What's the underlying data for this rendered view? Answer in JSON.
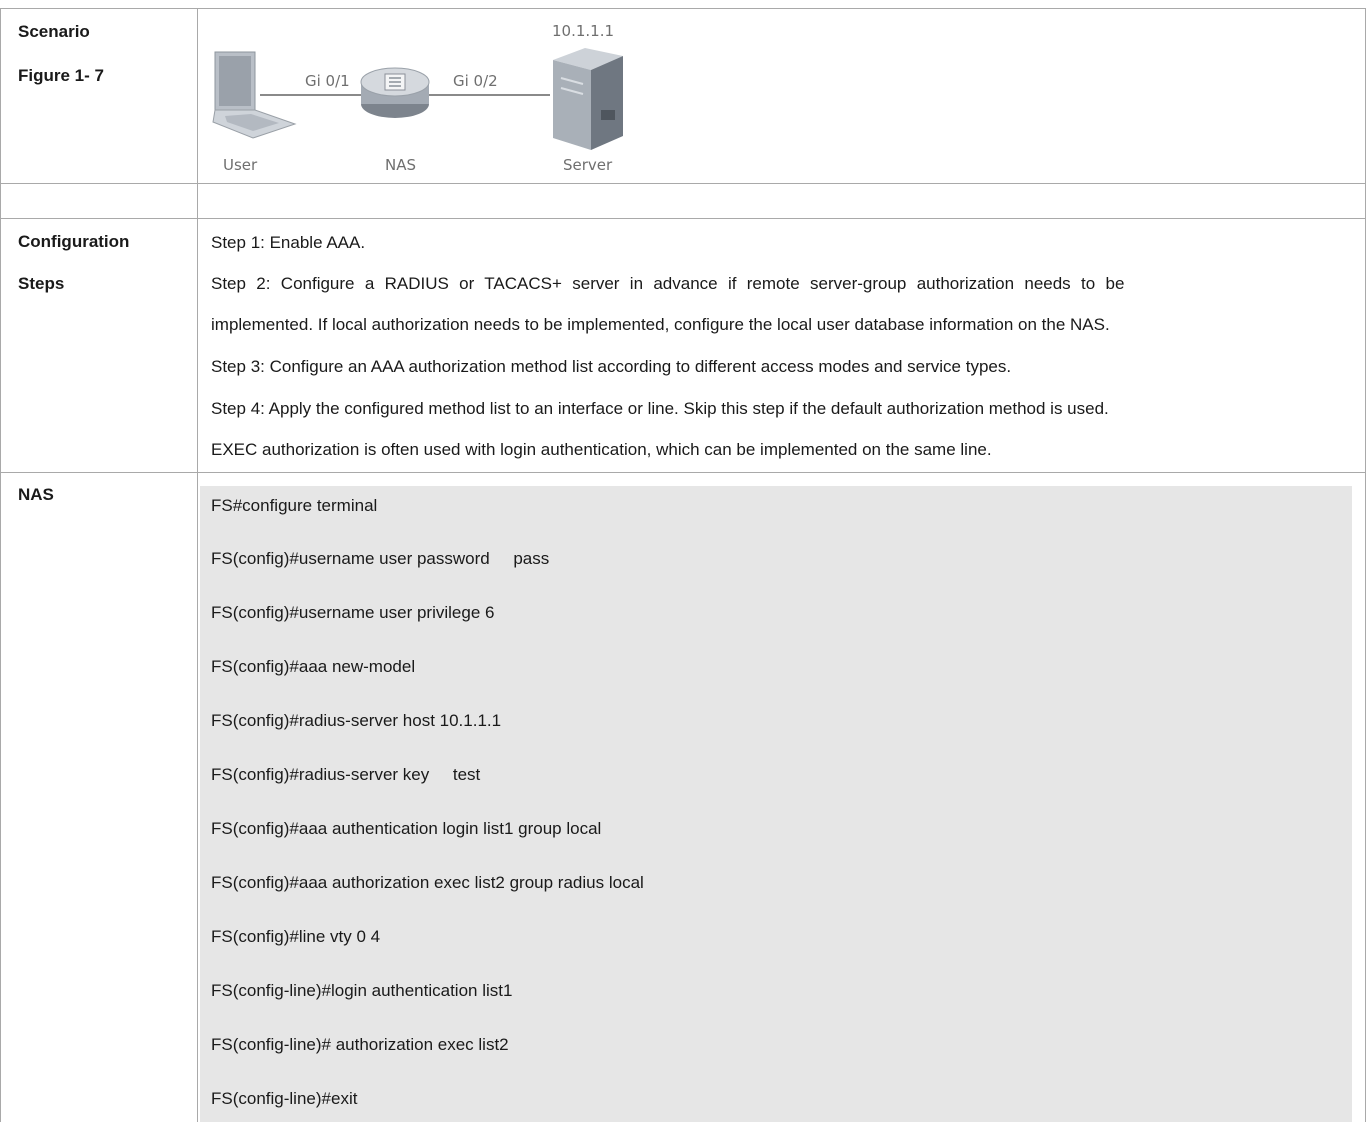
{
  "rows": {
    "scenario": {
      "label": "Scenario",
      "figure_label": "Figure 1- 7"
    },
    "config": {
      "label_line1": "Configuration",
      "label_line2": "Steps",
      "steps": [
        "Step 1: Enable AAA.",
        "Step 2: Configure a RADIUS or TACACS+ server in advance if remote server-group authorization needs to be",
        "implemented. If local authorization needs to be implemented, configure the local user database information on the NAS.",
        "Step 3: Configure an AAA authorization method list according to different access modes and service types.",
        "Step 4: Apply the configured method list to an interface or line. Skip this step if the default authorization method is used.",
        "EXEC authorization is often used with login authentication, which can be implemented on the same line."
      ]
    },
    "nas": {
      "label": "NAS",
      "commands": [
        "FS#configure terminal",
        "FS(config)#username user password     pass",
        "FS(config)#username user privilege 6",
        "FS(config)#aaa new-model",
        "FS(config)#radius-server host 10.1.1.1",
        "FS(config)#radius-server key     test",
        "FS(config)#aaa authentication login list1 group local",
        "FS(config)#aaa authorization exec list2 group radius local",
        "FS(config)#line vty 0 4",
        "FS(config-line)#login authentication list1",
        "FS(config-line)# authorization exec list2",
        "FS(config-line)#exit"
      ]
    }
  },
  "figure": {
    "server_ip": "10.1.1.1",
    "port_left": "Gi 0/1",
    "port_right": "Gi 0/2",
    "user_label": "User",
    "nas_label": "NAS",
    "server_label": "Server",
    "icons": [
      "laptop-icon",
      "switch-icon",
      "server-icon"
    ]
  }
}
